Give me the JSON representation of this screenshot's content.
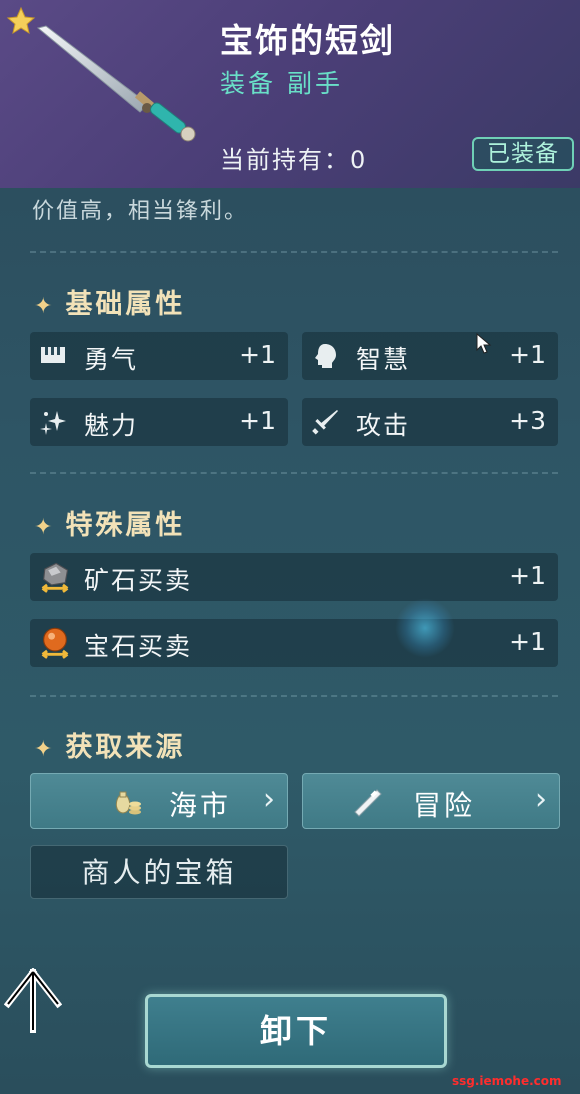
{
  "item": {
    "name": "宝饰的短剑",
    "type": "装备 副手",
    "holding": "当前持有：0",
    "equipped_badge": "已装备",
    "description": "价值高，相当锋利。"
  },
  "sections": {
    "base_title": "基础属性",
    "special_title": "特殊属性",
    "source_title": "获取来源"
  },
  "base_stats": [
    {
      "label": "勇气",
      "value": "+1",
      "icon": "courage-icon"
    },
    {
      "label": "智慧",
      "value": "+1",
      "icon": "wisdom-head-icon"
    },
    {
      "label": "魅力",
      "value": "+1",
      "icon": "charm-sparkle-icon"
    },
    {
      "label": "攻击",
      "value": "+3",
      "icon": "sword-icon"
    }
  ],
  "special_stats": [
    {
      "label": "矿石买卖",
      "value": "+1",
      "icon": "ore-trade-icon"
    },
    {
      "label": "宝石买卖",
      "value": "+1",
      "icon": "gem-trade-icon"
    }
  ],
  "sources": [
    {
      "label": "海市",
      "icon": "money-bag-icon"
    },
    {
      "label": "冒险",
      "icon": "telescope-icon"
    }
  ],
  "merchant_chest": "商人的宝箱",
  "unequip_label": "卸下",
  "watermark": "ssg.iemohe.com",
  "colors": {
    "header_purple": "#4c3f78",
    "type_teal": "#69e0c8",
    "section_gold": "#f2e2b8",
    "button_teal": "#3f7a86"
  }
}
